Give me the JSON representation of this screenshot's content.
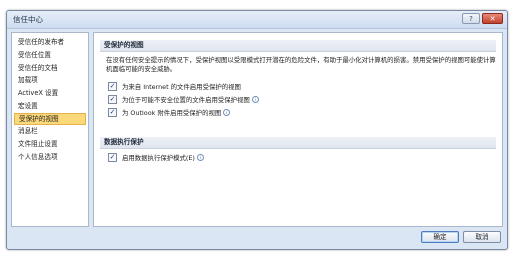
{
  "window": {
    "title": "信任中心",
    "help_label": "?",
    "close_label": "✕"
  },
  "sidebar": {
    "items": [
      {
        "label": "受信任的发布者",
        "active": false
      },
      {
        "label": "受信任位置",
        "active": false
      },
      {
        "label": "受信任的文档",
        "active": false
      },
      {
        "label": "加载项",
        "active": false
      },
      {
        "label": "ActiveX 设置",
        "active": false
      },
      {
        "label": "宏设置",
        "active": false
      },
      {
        "label": "受保护的视图",
        "active": true
      },
      {
        "label": "消息栏",
        "active": false
      },
      {
        "label": "文件阻止设置",
        "active": false
      },
      {
        "label": "个人信息选项",
        "active": false
      }
    ]
  },
  "protected_view": {
    "heading": "受保护的视图",
    "description": "在没有任何安全提示的情况下，受保护视图以受限模式打开潜在的危险文件，有助于最小化对计算机的损害。禁用受保护的视图可能使计算机面临可能的安全威胁。",
    "options": [
      {
        "label": "为来自 Internet 的文件启用受保护的视图",
        "checked": true,
        "info": false
      },
      {
        "label": "为位于可能不安全位置的文件启用受保护视图",
        "checked": true,
        "info": true
      },
      {
        "label": "为 Outlook 附件启用受保护的视图",
        "checked": true,
        "info": true
      }
    ]
  },
  "data_execution": {
    "heading": "数据执行保护",
    "options": [
      {
        "label": "启用数据执行保护模式(E)",
        "checked": true,
        "info": true
      }
    ]
  },
  "footer": {
    "ok_label": "确定",
    "cancel_label": "取消"
  },
  "icons": {
    "check": "✓",
    "info": "i"
  },
  "colors": {
    "active_item": "#fbd87a",
    "close_button": "#c2412c",
    "dialog_background": "#dbe6f4"
  }
}
